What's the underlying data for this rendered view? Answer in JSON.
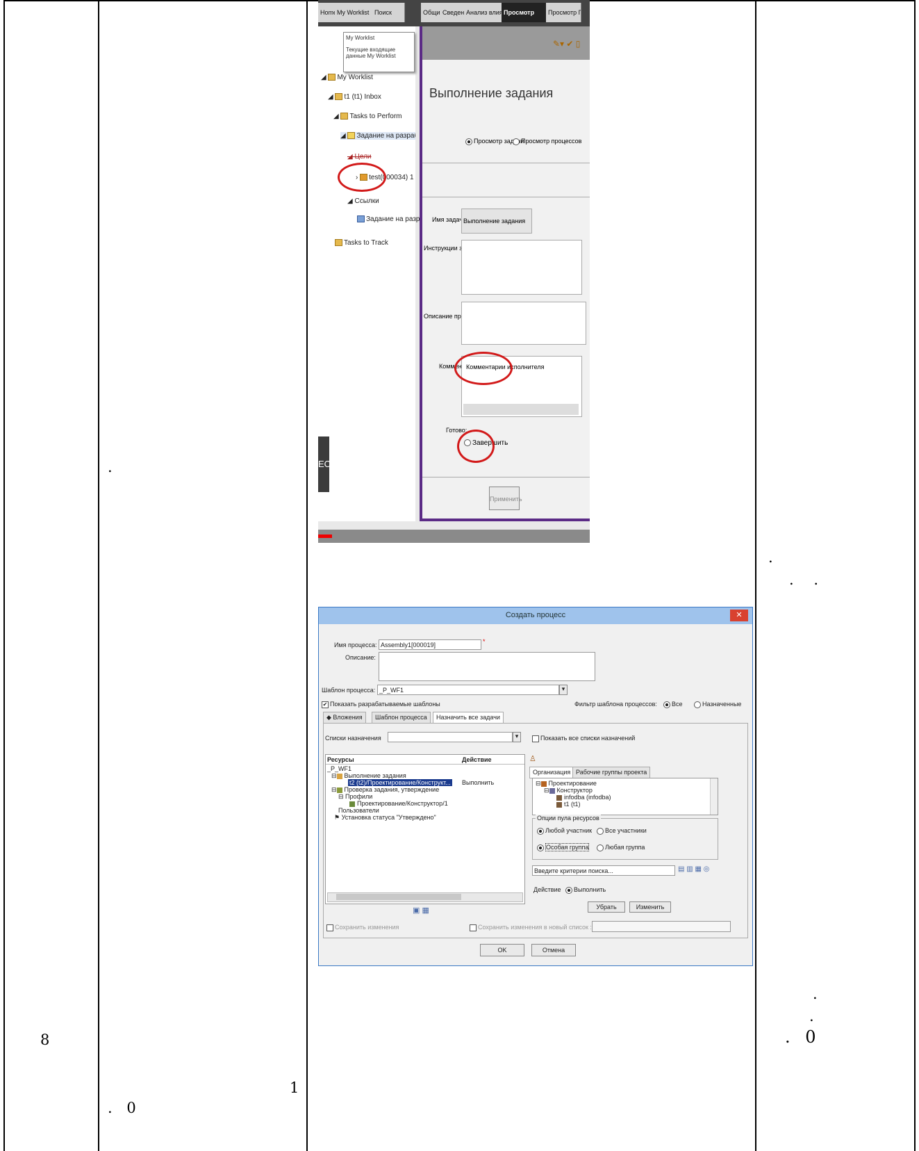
{
  "table": {
    "col1_number": "8",
    "col2_dot": ".",
    "col2_bottom_line1": "1",
    "col2_bottom_line2": ". 0",
    "col4_mid_line1": ".",
    "col4_mid_line2": ". .",
    "col4_bottom_line1": ".",
    "col4_bottom_line2": ".",
    "col4_bottom_line3": ". 0"
  },
  "shot1": {
    "tabs": [
      "Home",
      "My Worklist",
      "Поиск",
      "Общие",
      "Сведения",
      "Анализ влияния",
      "Просмотр",
      "Просмотр П"
    ],
    "tooltip_title": "My Worklist",
    "tooltip_text": "Текущие входящие данные My Worklist",
    "tree": {
      "root": "My Worklist",
      "inbox": "t1 (t1) Inbox",
      "perform": "Tasks to Perform",
      "task": "Задание на разработку (Выполнение",
      "targets": "Цели",
      "item": "test(000034) 1",
      "links": "Ссылки",
      "linked_task": "Задание на разработку",
      "track": "Tasks to Track"
    },
    "header": "Выполнение задания",
    "radio_view_task": "Просмотр задачи",
    "radio_view_process": "Просмотр процессов",
    "label_task_name": "Имя задачи:",
    "value_task_name": "Выполнение задания",
    "label_instructions": "Инструкции задачи:",
    "label_process_desc": "Описание процесса:",
    "label_comment": "Комментарии:",
    "value_comment": "Комментарии исполнителя",
    "label_ready": "Готово:",
    "radio_complete": "Завершить",
    "button_apply": "Применить",
    "side_label": "EO"
  },
  "shot2": {
    "title": "Создать процесс",
    "label_process_name": "Имя процесса:",
    "value_process_name": "Assembly1[000019]",
    "label_description": "Описание:",
    "label_template": "Шаблон процесса:",
    "value_template": "_P_WF1",
    "check_show_dev": "Показать разрабатываемые шаблоны",
    "filter_label": "Фильтр шаблона процессов:",
    "filter_all": "Все",
    "filter_assigned": "Назначенные",
    "tab_attachments": "Вложения",
    "tab_template": "Шаблон процесса",
    "tab_assign_all": "Назначить все задачи",
    "label_assign_lists": "Списки назначения",
    "check_show_all_lists": "Показать все списки назначений",
    "col_resources": "Ресурсы",
    "col_action": "Действие",
    "tree_root": "_P_WF1",
    "tree_items": [
      "Выполнение задания",
      "t2 (t2)/Проектирование/Конструкт...",
      "Проверка задания, утверждение",
      "Профили",
      "Проектирование/Конструктор/1",
      "Пользователи",
      "Установка статуса \"Утверждено\""
    ],
    "action_value": "Выполнить",
    "rtab_org": "Организация",
    "rtab_groups": "Рабочие группы проекта",
    "org_items": [
      "Проектирование",
      "Конструктор",
      "infodba (infodba)",
      "t1 (t1)"
    ],
    "pool_options_title": "Опции пула ресурсов",
    "pool_any_member": "Любой участник",
    "pool_all_members": "Все участники",
    "pool_special_group": "Особая группа",
    "pool_any_group": "Любая группа",
    "search_placeholder": "Введите критерии поиска...",
    "action_label": "Действие",
    "action_radio": "Выполнить",
    "button_remove": "Убрать",
    "button_change": "Изменить",
    "check_save_changes": "Сохранить изменения",
    "check_save_new_list": "Сохранить изменения в новый список :",
    "button_ok": "OK",
    "button_cancel": "Отмена"
  }
}
